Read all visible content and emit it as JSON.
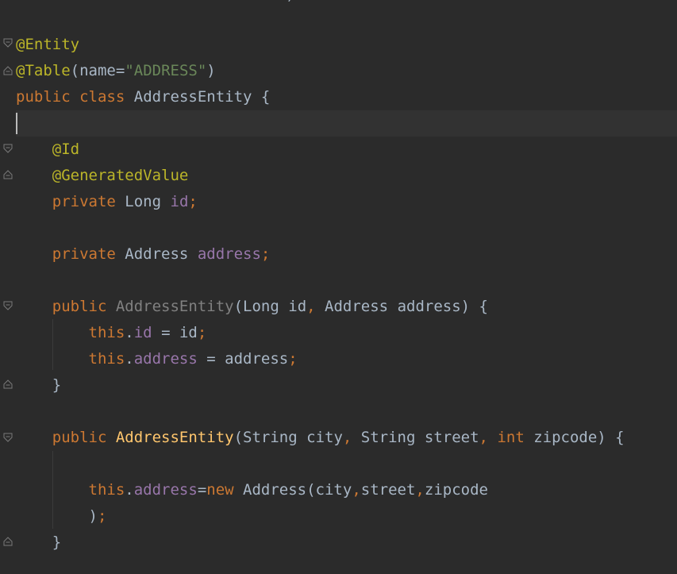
{
  "editor": {
    "colors": {
      "background": "#2b2b2b",
      "keyword": "#cc7832",
      "annotation": "#bbb529",
      "string": "#6a8759",
      "field": "#9876aa",
      "method": "#ffc66d",
      "default_text": "#a9b7c6",
      "unused": "#808080"
    },
    "top_line": ")",
    "l1": {
      "annotation": "@Entity"
    },
    "l2": {
      "annotation": "@Table",
      "open": "(",
      "param": "name",
      "eq": "=",
      "value": "\"ADDRESS\"",
      "close": ")"
    },
    "l3": {
      "kw1": "public",
      "kw2": "class",
      "name": "AddressEntity",
      "brace": "{"
    },
    "l5": {
      "annotation": "@Id"
    },
    "l6": {
      "annotation": "@GeneratedValue"
    },
    "l7": {
      "kw": "private",
      "type": "Long",
      "field": "id",
      "semi": ";"
    },
    "l9": {
      "kw": "private",
      "type": "Address",
      "field": "address",
      "semi": ";"
    },
    "l11": {
      "kw": "public",
      "name": "AddressEntity",
      "p1type": "Long",
      "p1name": "id",
      "comma": ",",
      "p2type": "Address",
      "p2name": "address",
      "tail": ") {"
    },
    "l12": {
      "this": "this",
      "dot": ".",
      "field": "id",
      "assign": " = ",
      "value": "id",
      "semi": ";"
    },
    "l13": {
      "this": "this",
      "dot": ".",
      "field": "address",
      "assign": " = ",
      "value": "address",
      "semi": ";"
    },
    "l14": {
      "brace": "}"
    },
    "l16": {
      "kw": "public",
      "name": "AddressEntity",
      "p1type": "String",
      "p1name": "city",
      "p2type": "String",
      "p2name": "street",
      "p3type": "int",
      "p3name": "zipcode",
      "comma": ",",
      "tail": ") {"
    },
    "l18": {
      "this": "this",
      "dot": ".",
      "field": "address",
      "eq": "=",
      "new": "new",
      "call": "Address(city",
      "c": ",",
      "arg2": "street",
      "arg3": "zipcode"
    },
    "l19": {
      "close": ")",
      "semi": ";"
    },
    "l20": {
      "brace": "}"
    }
  }
}
